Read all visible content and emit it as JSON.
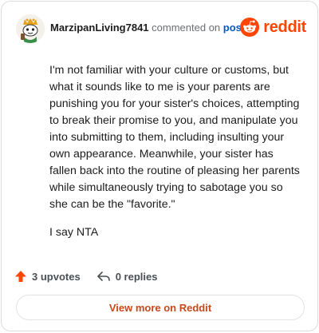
{
  "comment": {
    "username": "MarzipanLiving7841",
    "action_text": "commented on",
    "post_link": "post",
    "paragraphs": [
      "I'm not familiar with your culture or customs, but what it sounds like to me is your parents are punishing you for your sister's choices, attempting to break their promise to you, and manipulate you into submitting to them, including insulting your own appearance. Meanwhile, your sister has fallen back into the routine of pleasing her parents while simultaneously trying to sabotage you so she can be the \"favorite.\"",
      "I say NTA"
    ],
    "upvotes": "3 upvotes",
    "replies": "0 replies"
  },
  "brand": {
    "wordmark": "reddit",
    "color": "#ff4500"
  },
  "footer": {
    "view_more_label": "View more on Reddit"
  },
  "icons": {
    "avatar": "snoo-avatar",
    "logo": "reddit-alien-icon",
    "upvote": "upvote-arrow-icon",
    "reply": "reply-arrow-icon"
  }
}
